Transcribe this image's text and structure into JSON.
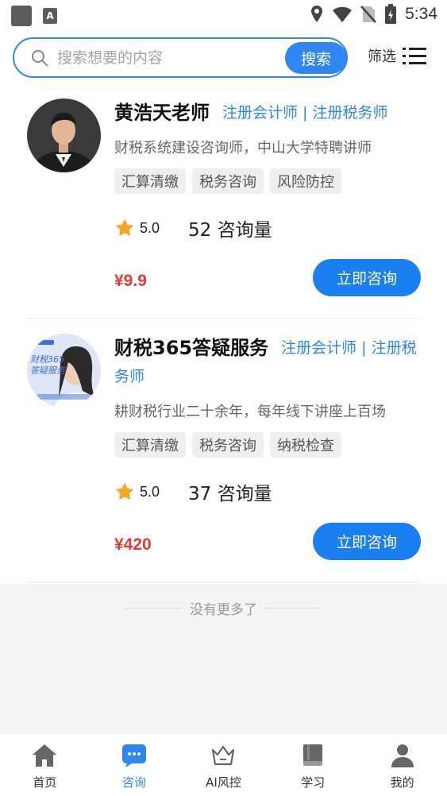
{
  "status_bar": {
    "time": "5:34",
    "app_badge": "A"
  },
  "search": {
    "placeholder": "搜索想要的内容",
    "button": "搜索",
    "filter_label": "筛选"
  },
  "consultants": [
    {
      "name": "黄浩天老师",
      "certs": "注册会计师 | 注册税务师",
      "desc": "财税系统建设咨询师，中山大学特聘讲师",
      "tags": [
        "汇算清缴",
        "税务咨询",
        "风险防控"
      ],
      "rating": "5.0",
      "consults": "52 咨询量",
      "price": "¥9.9",
      "button": "立即咨询"
    },
    {
      "name": "财税365答疑服务",
      "certs": "注册会计师 | 注册税务师",
      "desc": "耕财税行业二十余年，每年线下讲座上百场",
      "tags": [
        "汇算清缴",
        "税务咨询",
        "纳税检查"
      ],
      "rating": "5.0",
      "consults": "37 咨询量",
      "price": "¥420",
      "button": "立即咨询",
      "avatar_text": "财税365答疑服务"
    }
  ],
  "no_more": "没有更多了",
  "nav": [
    {
      "label": "首页",
      "icon": "home-icon"
    },
    {
      "label": "咨询",
      "icon": "chat-icon"
    },
    {
      "label": "AI风控",
      "icon": "crown-icon"
    },
    {
      "label": "学习",
      "icon": "book-icon"
    },
    {
      "label": "我的",
      "icon": "user-icon"
    }
  ],
  "colors": {
    "accent": "#2f86f0",
    "price": "#e53935",
    "star": "#f5a623"
  }
}
